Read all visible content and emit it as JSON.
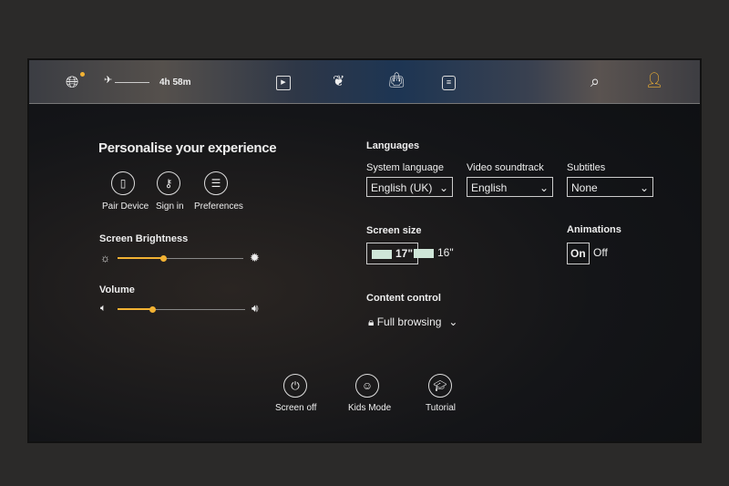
{
  "topbar": {
    "flight_time": "4h 58m",
    "icons": [
      "globe-icon",
      "flight-progress-icon",
      "movies-icon",
      "bird-logo-icon",
      "shopping-bag-icon",
      "menu-document-icon",
      "search-icon",
      "user-settings-icon"
    ]
  },
  "personalise": {
    "title": "Personalise your experience",
    "pair_device": "Pair Device",
    "sign_in": "Sign in",
    "preferences": "Preferences"
  },
  "brightness": {
    "label": "Screen Brightness",
    "value_percent": 36
  },
  "volume": {
    "label": "Volume",
    "value_percent": 27
  },
  "languages": {
    "title": "Languages",
    "system_language": {
      "label": "System language",
      "value": "English (UK)"
    },
    "video_soundtrack": {
      "label": "Video soundtrack",
      "value": "English"
    },
    "subtitles": {
      "label": "Subtitles",
      "value": "None"
    }
  },
  "screen_size": {
    "label": "Screen size",
    "options": [
      "17\"",
      "16\""
    ],
    "selected": "17\""
  },
  "animations": {
    "label": "Animations",
    "on": "On",
    "off": "Off",
    "selected": "On"
  },
  "content_control": {
    "label": "Content control",
    "value": "Full browsing"
  },
  "bottom": {
    "screen_off": "Screen off",
    "kids_mode": "Kids Mode",
    "tutorial": "Tutorial"
  },
  "colors": {
    "accent": "#f2b233"
  }
}
